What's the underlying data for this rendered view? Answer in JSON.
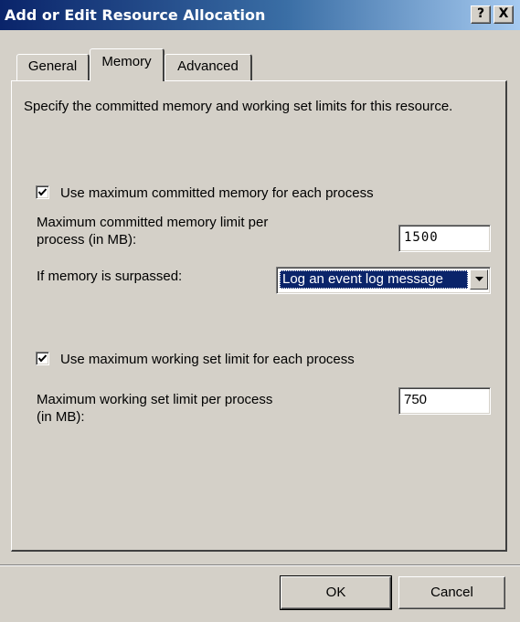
{
  "window": {
    "title": "Add or Edit Resource Allocation",
    "help_button": "?",
    "close_button": "X"
  },
  "tabs": [
    {
      "label": "General",
      "active": false
    },
    {
      "label": "Memory",
      "active": true
    },
    {
      "label": "Advanced",
      "active": false
    }
  ],
  "memory": {
    "description": "Specify the committed memory and working set limits for this resource.",
    "committed": {
      "checkbox_label": "Use maximum committed memory for each process",
      "checked": true,
      "limit_label_line1": "Maximum committed memory limit per",
      "limit_label_line2": "process (in MB):",
      "limit_value": "1500",
      "surpassed_label": "If memory is surpassed:",
      "surpassed_selected": "Log an event log message"
    },
    "working_set": {
      "checkbox_label": "Use maximum working set limit for each process",
      "checked": true,
      "limit_label_line1": "Maximum working set limit per process",
      "limit_label_line2": "(in MB):",
      "limit_value": "750"
    }
  },
  "buttons": {
    "ok": "OK",
    "cancel": "Cancel"
  },
  "colors": {
    "titlebar_start": "#0a246a",
    "titlebar_end": "#a6caf0",
    "face": "#d4d0c8",
    "selection": "#0a246a"
  }
}
